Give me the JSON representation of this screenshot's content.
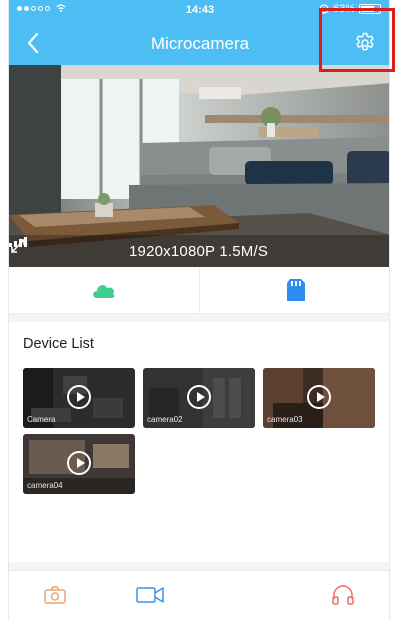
{
  "status_bar": {
    "time": "14:43",
    "battery": "63%"
  },
  "nav": {
    "title": "Microcamera"
  },
  "live_view": {
    "resolution": "1920x1080P",
    "bitrate": "1.5M/S"
  },
  "device_list": {
    "title": "Device List",
    "devices": [
      {
        "label": "Camera"
      },
      {
        "label": "camera02"
      },
      {
        "label": "camera03"
      },
      {
        "label": "camera04"
      }
    ]
  },
  "colors": {
    "header_blue": "#4dbef3",
    "cloud_green": "#3ecf8e",
    "sd_blue": "#2d8ef0",
    "snapshot_orange": "#f0a36d",
    "record_blue": "#3d8ff0",
    "talk_red": "#f06a73",
    "highlight_red": "#e01b1b"
  },
  "icons": [
    "back-icon",
    "settings-gear-icon",
    "signal-bars-icon",
    "fullscreen-icon",
    "cloud-icon",
    "sd-card-icon",
    "play-icon",
    "snapshot-icon",
    "video-record-icon",
    "headphones-icon"
  ]
}
